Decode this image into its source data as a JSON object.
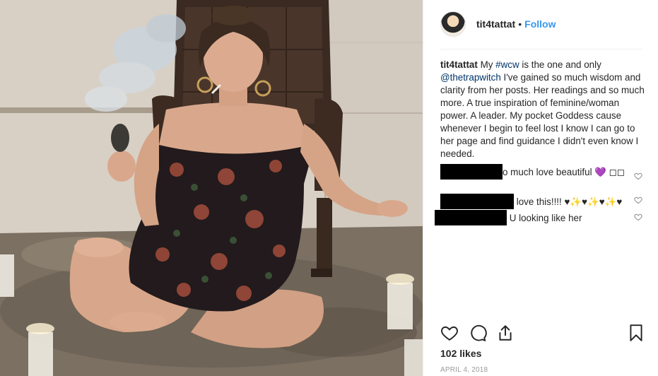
{
  "header": {
    "username": "tit4tattat",
    "separator": "•",
    "follow_label": "Follow"
  },
  "caption": {
    "username": "tit4tattat",
    "text_1": "My",
    "hashtag": "#wcw",
    "text_2": "is the one and only",
    "mention": "@thetrapwitch",
    "text_3": "I've gained so much wisdom and clarity from her posts. Her readings and so much more. A true inspiration of feminine/woman power. A leader. My pocket Goddess cause whenever I begin to feel lost I know I can go to her page and find guidance I didn't even know I needed."
  },
  "comments": [
    {
      "text": "o much love beautiful 💜 ◻◻"
    },
    {
      "text": "love this!!!! ♥✨♥✨♥✨♥"
    },
    {
      "text": "U looking like her"
    }
  ],
  "actions": {
    "like_icon": "heart-icon",
    "comment_icon": "comment-icon",
    "share_icon": "share-icon",
    "save_icon": "bookmark-icon"
  },
  "likes": "102 likes",
  "date": "APRIL 4, 2018"
}
